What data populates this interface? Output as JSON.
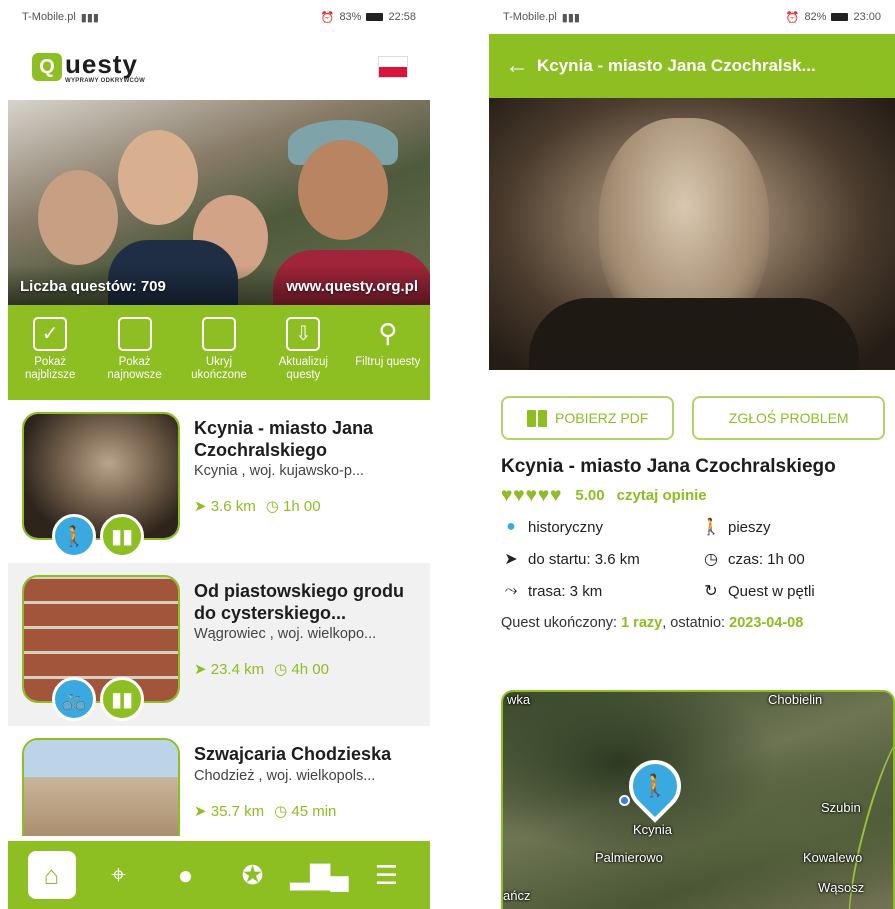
{
  "left": {
    "status": {
      "carrier": "T-Mobile.pl",
      "battery": "83%",
      "time": "22:58"
    },
    "logo": {
      "mark": "Q",
      "word": "uesty",
      "tagline": "WYPRAWY ODKRYWCÓW"
    },
    "hero": {
      "count_label": "Liczba questów: 709",
      "site": "www.questy.org.pl"
    },
    "actions": [
      {
        "label": "Pokaż najbliższe",
        "icon": "checked-box-icon"
      },
      {
        "label": "Pokaż najnowsze",
        "icon": "empty-box-icon"
      },
      {
        "label": "Ukryj ukończone",
        "icon": "empty-box-icon"
      },
      {
        "label": "Aktualizuj questy",
        "icon": "download-icon"
      },
      {
        "label": "Filtruj questy",
        "icon": "search-icon"
      }
    ],
    "quests": [
      {
        "title": "Kcynia - miasto Jana Czochralskiego",
        "location": "Kcynia , woj. kujawsko-p...",
        "distance": "3.6 km",
        "time": "1h 00",
        "mode_icon": "hiker-icon"
      },
      {
        "title": "Od piastowskiego grodu do cysterskiego...",
        "location": "Wągrowiec , woj. wielkopo...",
        "distance": "23.4 km",
        "time": "4h 00",
        "mode_icon": "bicycle-icon"
      },
      {
        "title": "Szwajcaria Chodzieska",
        "location": "Chodzież , woj. wielkopols...",
        "distance": "35.7 km",
        "time": "45 min",
        "mode_icon": "hiker-icon"
      }
    ],
    "nav": [
      "home-icon",
      "map-pin-icon",
      "profile-icon",
      "award-icon",
      "podium-icon",
      "menu-icon"
    ]
  },
  "right": {
    "status": {
      "carrier": "T-Mobile.pl",
      "battery": "82%",
      "time": "23:00"
    },
    "appbar_title": "Kcynia - miasto Jana Czochralsk...",
    "btn_pdf": "POBIERZ PDF",
    "btn_problem": "ZGŁOŚ PROBLEM",
    "title": "Kcynia - miasto Jana Czochralskiego",
    "rating": "5.00",
    "reviews_link": "czytaj opinie",
    "category": "historyczny",
    "mode": "pieszy",
    "to_start": "do startu: 3.6 km",
    "time": "czas: 1h 00",
    "route": "trasa: 3 km",
    "loop": "Quest w pętli",
    "completed_prefix": "Quest ukończony: ",
    "completed_count": "1 razy",
    "completed_mid": ", ostatnio: ",
    "completed_date": "2023-04-08",
    "map_labels": [
      "wka",
      "Chobielin",
      "Szubin",
      "Kcynia",
      "Palmierowo",
      "Kowalewo",
      "Wąsosz",
      "ańcz"
    ],
    "accent": "#8dbe22",
    "marker_color": "#3aa9e0"
  }
}
